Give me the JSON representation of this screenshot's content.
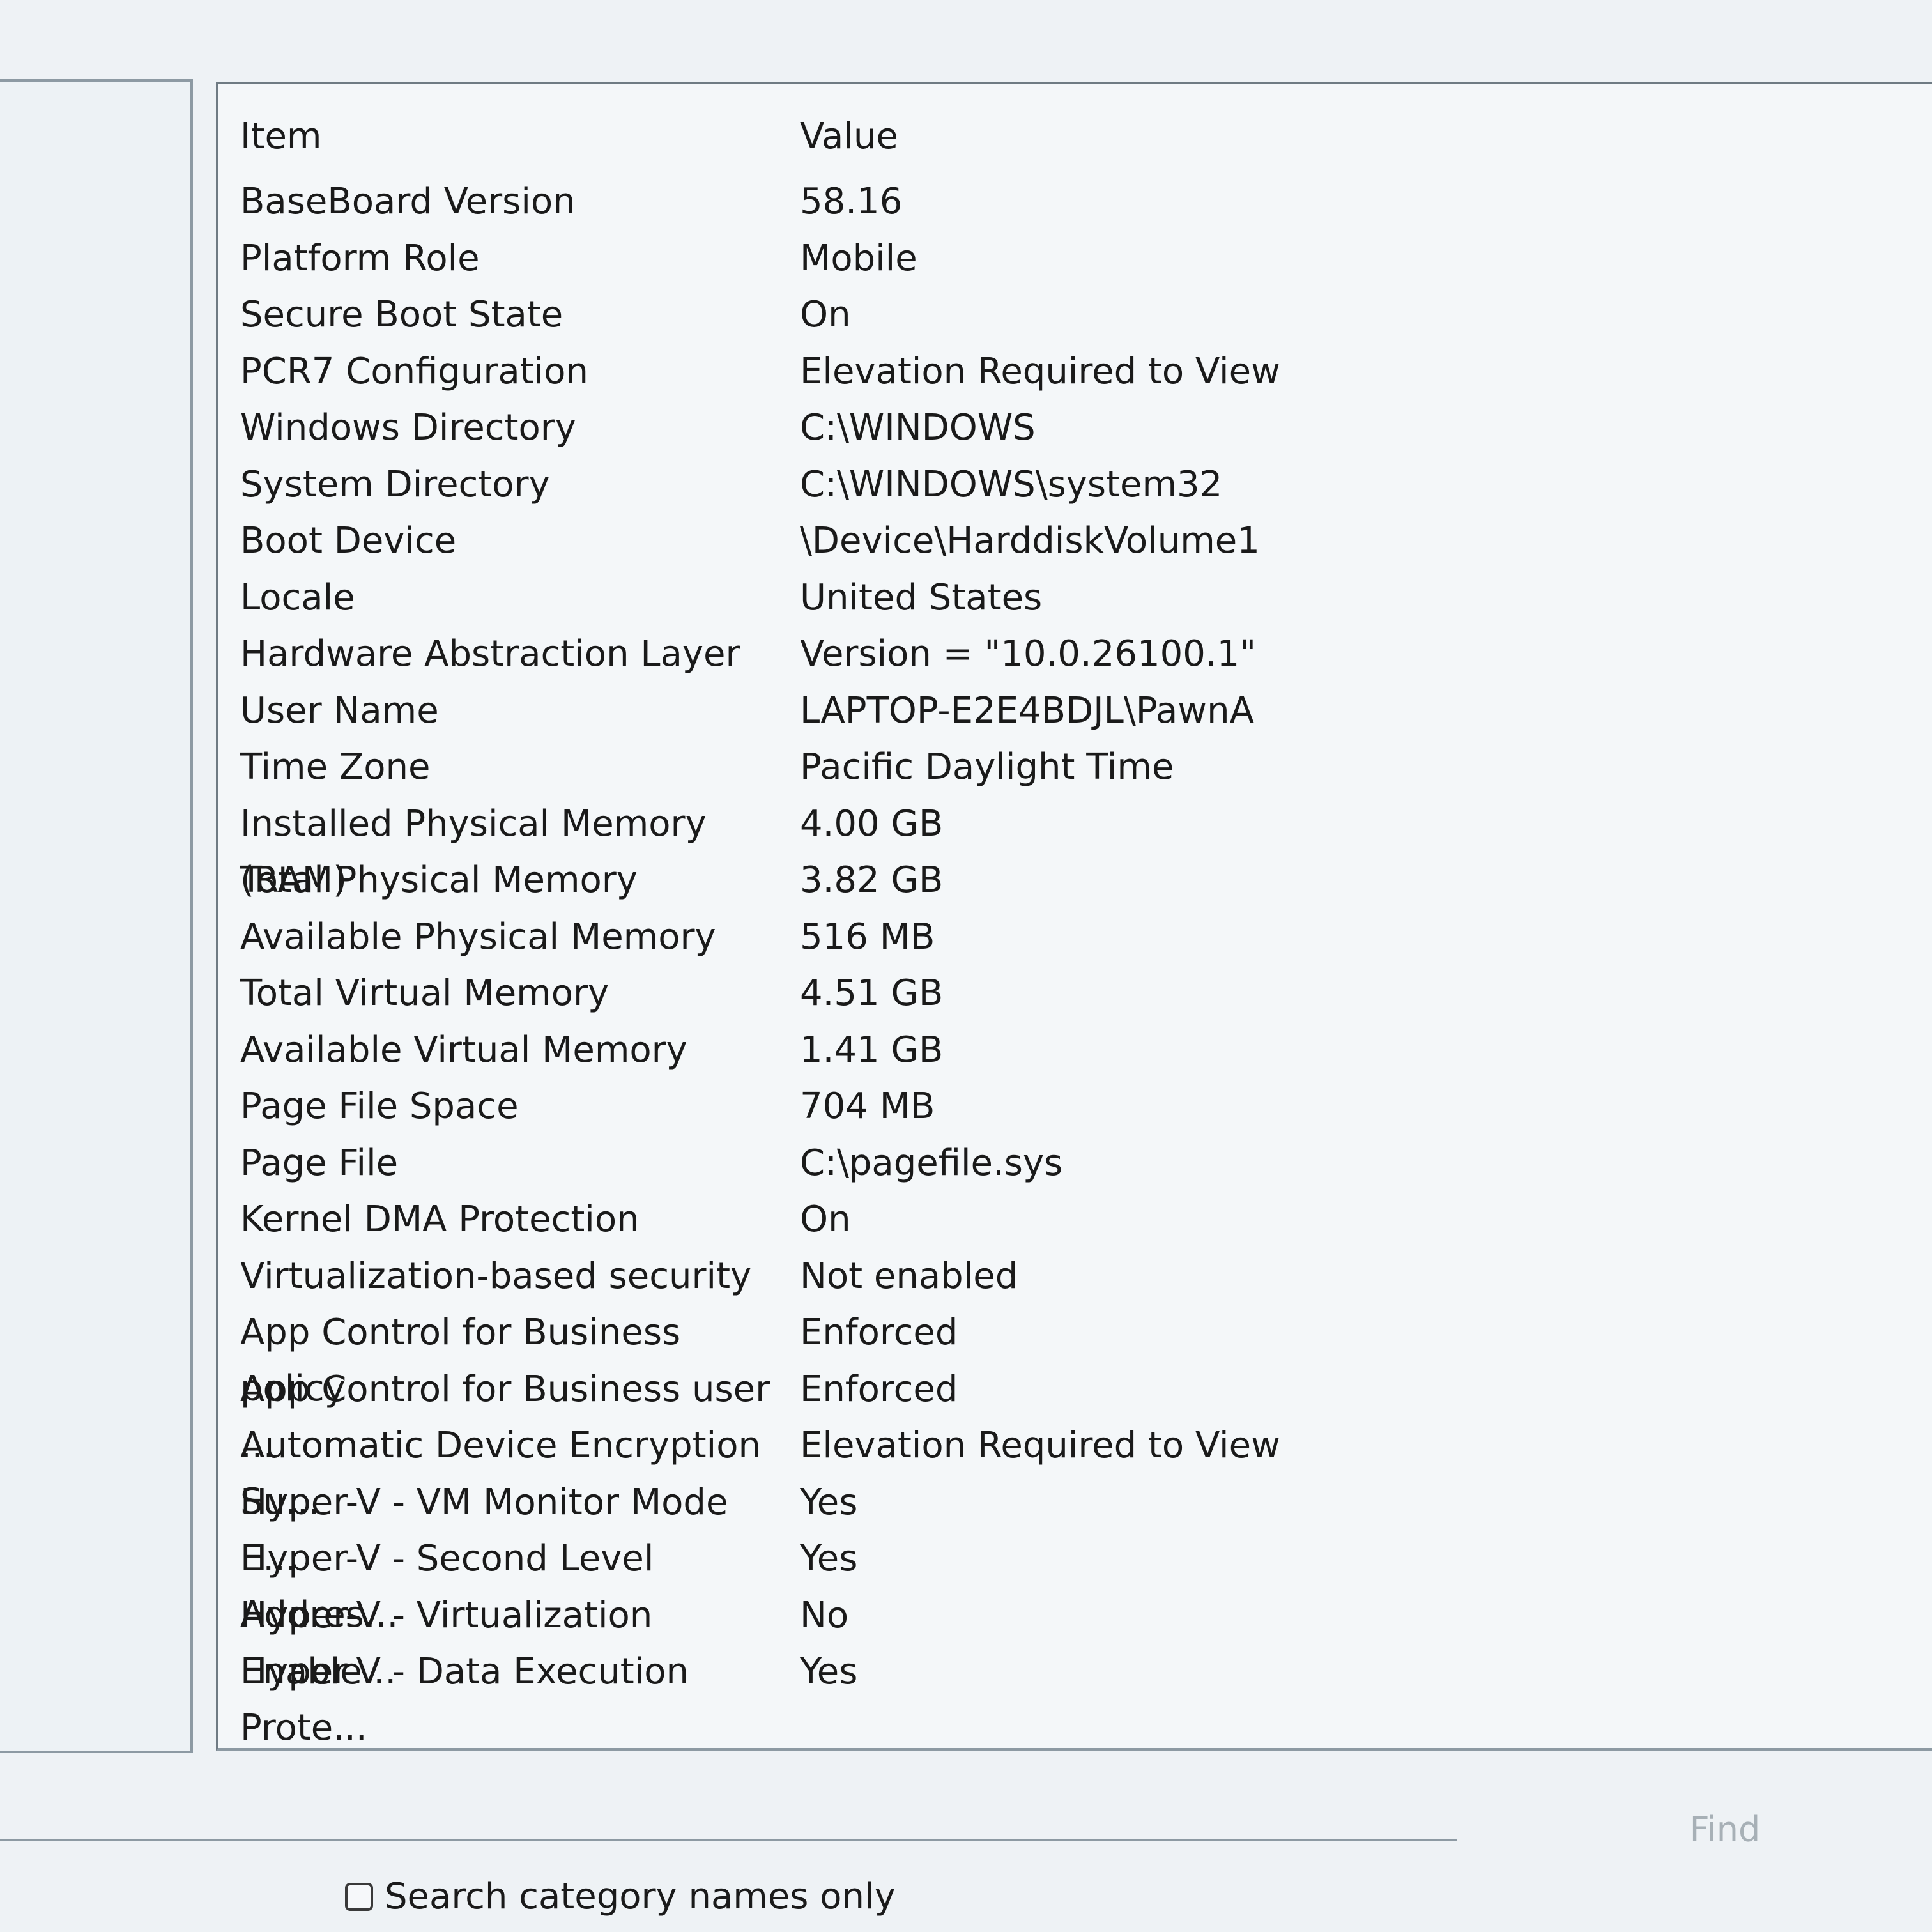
{
  "columns": {
    "item": "Item",
    "value": "Value"
  },
  "rows": [
    {
      "item": "BaseBoard Version",
      "value": "58.16"
    },
    {
      "item": "Platform Role",
      "value": "Mobile"
    },
    {
      "item": "Secure Boot State",
      "value": "On"
    },
    {
      "item": "PCR7 Configuration",
      "value": "Elevation Required to View"
    },
    {
      "item": "Windows Directory",
      "value": "C:\\WINDOWS"
    },
    {
      "item": "System Directory",
      "value": "C:\\WINDOWS\\system32"
    },
    {
      "item": "Boot Device",
      "value": "\\Device\\HarddiskVolume1"
    },
    {
      "item": "Locale",
      "value": "United States"
    },
    {
      "item": "Hardware Abstraction Layer",
      "value": "Version = \"10.0.26100.1\""
    },
    {
      "item": "User Name",
      "value": "LAPTOP-E2E4BDJL\\PawnA"
    },
    {
      "item": "Time Zone",
      "value": "Pacific Daylight Time"
    },
    {
      "item": "Installed Physical Memory (RAM)",
      "value": "4.00 GB"
    },
    {
      "item": "Total Physical Memory",
      "value": "3.82 GB"
    },
    {
      "item": "Available Physical Memory",
      "value": "516 MB"
    },
    {
      "item": "Total Virtual Memory",
      "value": "4.51 GB"
    },
    {
      "item": "Available Virtual Memory",
      "value": "1.41 GB"
    },
    {
      "item": "Page File Space",
      "value": "704 MB"
    },
    {
      "item": "Page File",
      "value": "C:\\pagefile.sys"
    },
    {
      "item": "Kernel DMA Protection",
      "value": "On"
    },
    {
      "item": "Virtualization-based security",
      "value": "Not enabled"
    },
    {
      "item": "App Control for Business policy",
      "value": "Enforced"
    },
    {
      "item": "App Control for Business user ...",
      "value": "Enforced"
    },
    {
      "item": "Automatic Device Encryption Su...",
      "value": "Elevation Required to View"
    },
    {
      "item": "Hyper-V - VM Monitor Mode E...",
      "value": "Yes"
    },
    {
      "item": "Hyper-V - Second Level Addres...",
      "value": "Yes"
    },
    {
      "item": "Hyper-V - Virtualization Enable...",
      "value": "No"
    },
    {
      "item": "Hyper-V - Data Execution Prote...",
      "value": "Yes"
    }
  ],
  "find": {
    "button_label": "Find"
  },
  "search_option": {
    "label": "Search category names only",
    "checked": false
  }
}
